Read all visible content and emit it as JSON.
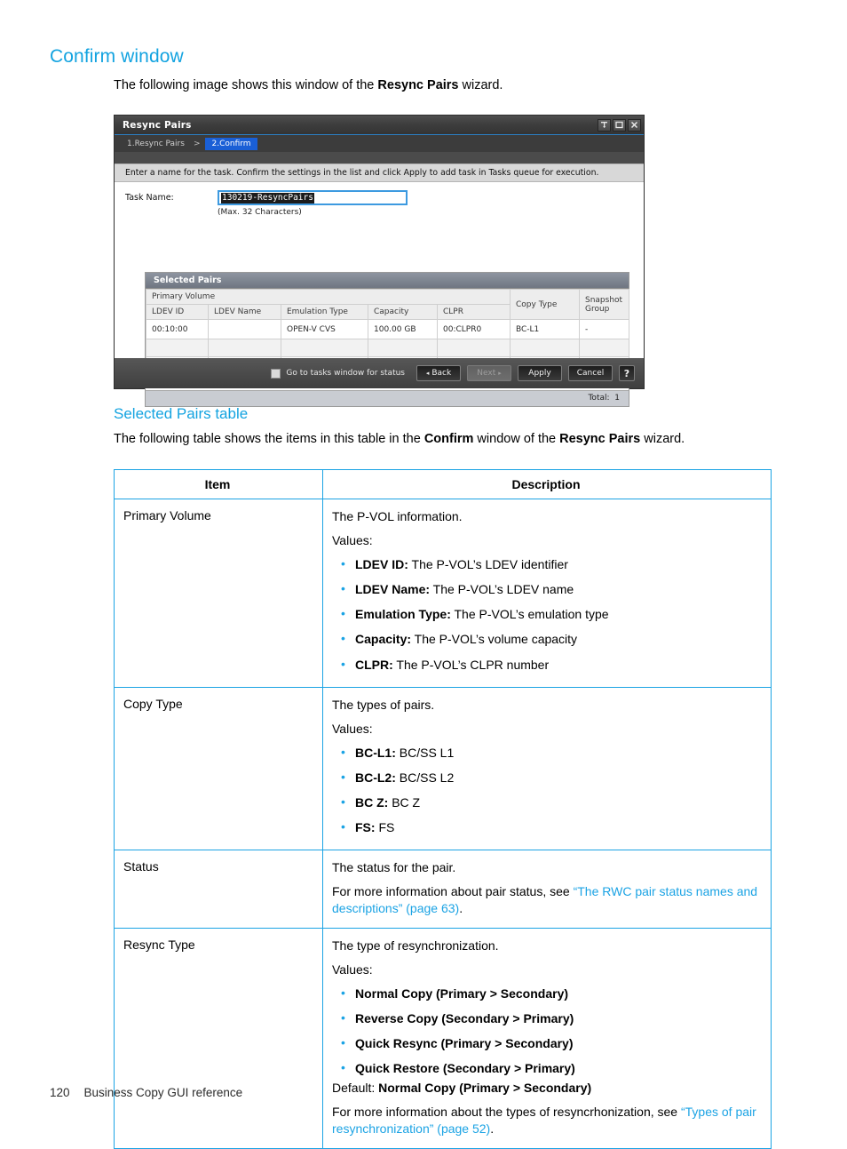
{
  "document": {
    "heading": "Confirm window",
    "intro_prefix": "The following image shows this window of the ",
    "intro_bold": "Resync Pairs",
    "intro_suffix": " wizard.",
    "sub_heading": "Selected Pairs table",
    "sub_para_part1": "The following table shows the items in this table in the ",
    "sub_para_bold1": "Confirm",
    "sub_para_part2": " window of the ",
    "sub_para_bold2": "Resync Pairs",
    "sub_para_part3": " wizard.",
    "footer_page_number": "120",
    "footer_title": "Business Copy GUI reference",
    "accent_color": "#1ba3e4"
  },
  "dialog": {
    "title": "Resync Pairs",
    "window_controls": [
      {
        "name": "pin-icon",
        "glyph": "pin"
      },
      {
        "name": "maximize-icon",
        "glyph": "square"
      },
      {
        "name": "close-icon",
        "glyph": "x"
      }
    ],
    "breadcrumb": {
      "step1": "1.Resync Pairs",
      "separator": ">",
      "step2": "2.Confirm",
      "active_color": "#1a5fd6"
    },
    "instruction": "Enter a name for the task. Confirm the settings in the list and click Apply to add task in Tasks queue for execution.",
    "task_name": {
      "label": "Task Name:",
      "value": "130219-ResyncPairs",
      "hint": "(Max. 32 Characters)"
    },
    "selected_pairs": {
      "caption": "Selected Pairs",
      "group_header": "Primary Volume",
      "columns": [
        "LDEV ID",
        "LDEV Name",
        "Emulation Type",
        "Capacity",
        "CLPR",
        "Copy Type",
        "Snapshot Group"
      ],
      "copy_type_header": "Copy Type",
      "snapshot_group_header_line1": "Snapshot",
      "snapshot_group_header_line2": "Group",
      "rows": [
        {
          "ldev_id": "00:10:00",
          "ldev_name": "",
          "emulation_type": "OPEN-V CVS",
          "capacity": "100.00 GB",
          "clpr": "00:CLPR0",
          "copy_type": "BC-L1",
          "snapshot_group": "-"
        }
      ],
      "total_label": "Total:",
      "total_value": "1"
    },
    "footer": {
      "checkbox_label": "Go to tasks window for status",
      "checkbox_checked": false,
      "back_label": "Back",
      "next_label": "Next",
      "next_disabled": true,
      "apply_label": "Apply",
      "cancel_label": "Cancel",
      "help_label": "?"
    }
  },
  "reference_table": {
    "headers": {
      "item": "Item",
      "description": "Description"
    },
    "rows": [
      {
        "item": "Primary Volume",
        "lines": [
          "The P-VOL information.",
          "Values:"
        ],
        "bullets": [
          {
            "term": "LDEV ID:",
            "text": " The P-VOL’s LDEV identifier"
          },
          {
            "term": "LDEV Name:",
            "text": " The P-VOL’s LDEV name"
          },
          {
            "term": "Emulation Type:",
            "text": " The P-VOL’s emulation type"
          },
          {
            "term": "Capacity:",
            "text": " The P-VOL’s volume capacity"
          },
          {
            "term": "CLPR:",
            "text": " The P-VOL’s CLPR number"
          }
        ]
      },
      {
        "item": "Copy Type",
        "lines": [
          "The types of pairs.",
          "Values:"
        ],
        "bullets": [
          {
            "term": "BC-L1:",
            "text": " BC/SS L1"
          },
          {
            "term": "BC-L2:",
            "text": " BC/SS L2"
          },
          {
            "term": "BC Z:",
            "text": " BC Z"
          },
          {
            "term": "FS:",
            "text": " FS"
          }
        ]
      },
      {
        "item": "Status",
        "lines": [
          "The status for the pair."
        ],
        "link_sentence": {
          "prefix": "For more information about pair status, see ",
          "link": "“The RWC pair status names and descriptions” (page 63)",
          "suffix": "."
        }
      },
      {
        "item": "Resync Type",
        "lines": [
          "The type of resynchronization.",
          "Values:"
        ],
        "bullets": [
          {
            "term": "Normal Copy (Primary > Secondary)",
            "text": ""
          },
          {
            "term": "Reverse Copy (Secondary > Primary)",
            "text": ""
          },
          {
            "term": "Quick Resync (Primary > Secondary)",
            "text": ""
          },
          {
            "term": "Quick Restore (Secondary > Primary)",
            "text": ""
          }
        ],
        "default_line": {
          "prefix": "Default: ",
          "bold": "Normal Copy (Primary > Secondary)"
        },
        "link_sentence": {
          "prefix": "For more information about the types of resyncrhonization, see ",
          "link": "“Types of pair resynchronization” (page 52)",
          "suffix": "."
        }
      }
    ]
  }
}
